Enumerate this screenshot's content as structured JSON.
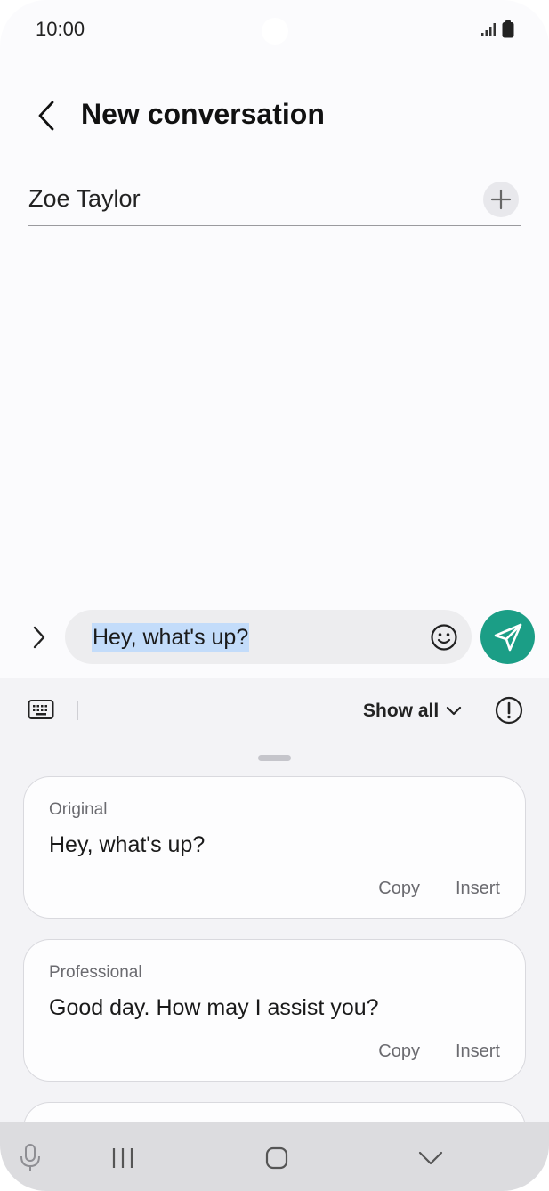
{
  "status_bar": {
    "time": "10:00",
    "icons": [
      "signal-icon",
      "battery-icon"
    ]
  },
  "header": {
    "title": "New conversation",
    "back_icon": "chevron-left-icon"
  },
  "recipient": {
    "name": "Zoe Taylor",
    "add_icon": "plus-icon"
  },
  "compose": {
    "message": "Hey, what's up?",
    "expand_icon": "chevron-right-icon",
    "emoji_icon": "smiley-icon",
    "send_icon": "send-icon",
    "send_color": "#1b9e86",
    "selection_color": "#c3dcfa"
  },
  "ai_panel": {
    "keyboard_icon": "keyboard-icon",
    "show_all_label": "Show all",
    "info_icon": "exclamation-circle-icon",
    "suggestions": [
      {
        "label": "Original",
        "text": "Hey, what's up?",
        "copy_label": "Copy",
        "insert_label": "Insert"
      },
      {
        "label": "Professional",
        "text": "Good day. How may I assist you?",
        "copy_label": "Copy",
        "insert_label": "Insert"
      }
    ]
  },
  "nav_bar": {
    "icons": [
      "microphone-icon",
      "recent-apps-icon",
      "home-icon",
      "hide-keyboard-icon"
    ]
  }
}
